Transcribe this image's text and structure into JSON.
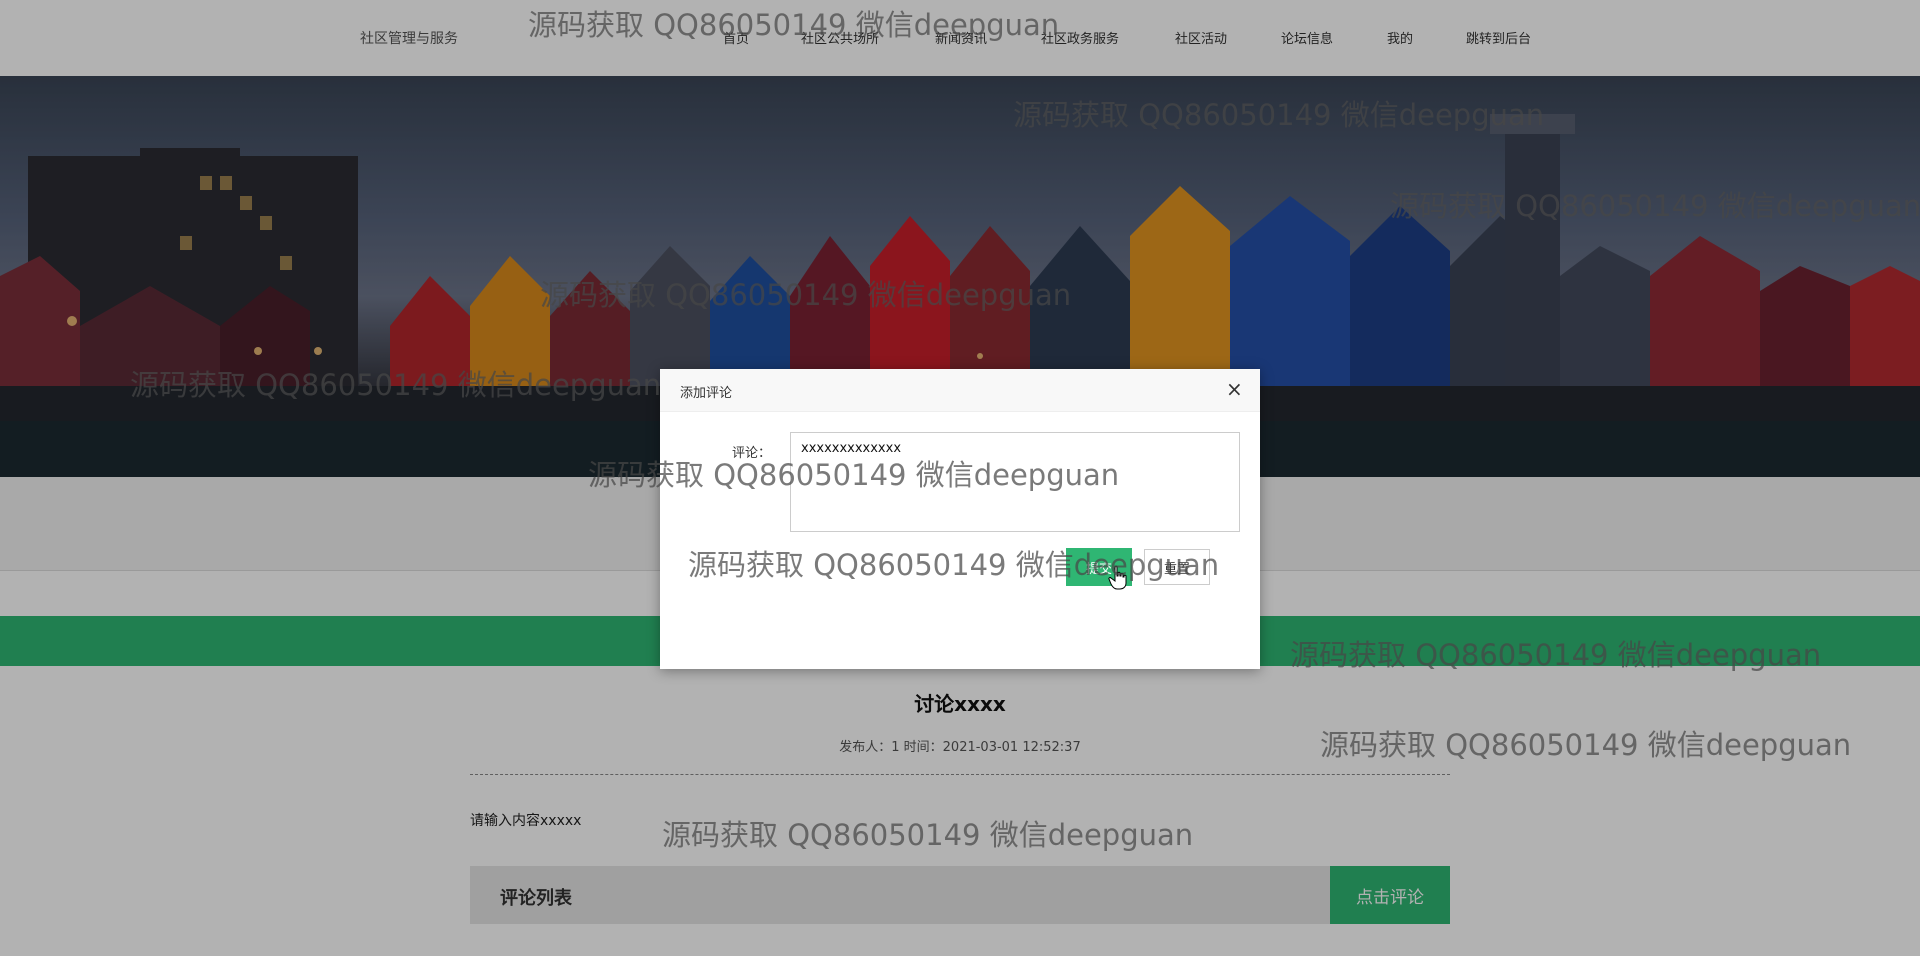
{
  "nav": {
    "brand": "社区管理与服务",
    "items": [
      "首页",
      "社区公共场所",
      "新闻资讯",
      "社区政务服务",
      "社区活动",
      "论坛信息",
      "我的",
      "跳转到后台"
    ]
  },
  "post": {
    "title": "讨论xxxx",
    "meta": "发布人：1 时间：2021-03-01 12:52:37",
    "content": "请输入内容xxxxx"
  },
  "comments": {
    "list_label": "评论列表",
    "add_button": "点击评论"
  },
  "dialog": {
    "title": "添加评论",
    "close_icon": "×",
    "comment_label": "评论：",
    "comment_value": "xxxxxxxxxxxxx",
    "submit_label": "提交",
    "reset_label": "重置"
  },
  "watermark": "源码获取 QQ86050149 微信deepguan",
  "colors": {
    "accent": "#2fb673"
  }
}
